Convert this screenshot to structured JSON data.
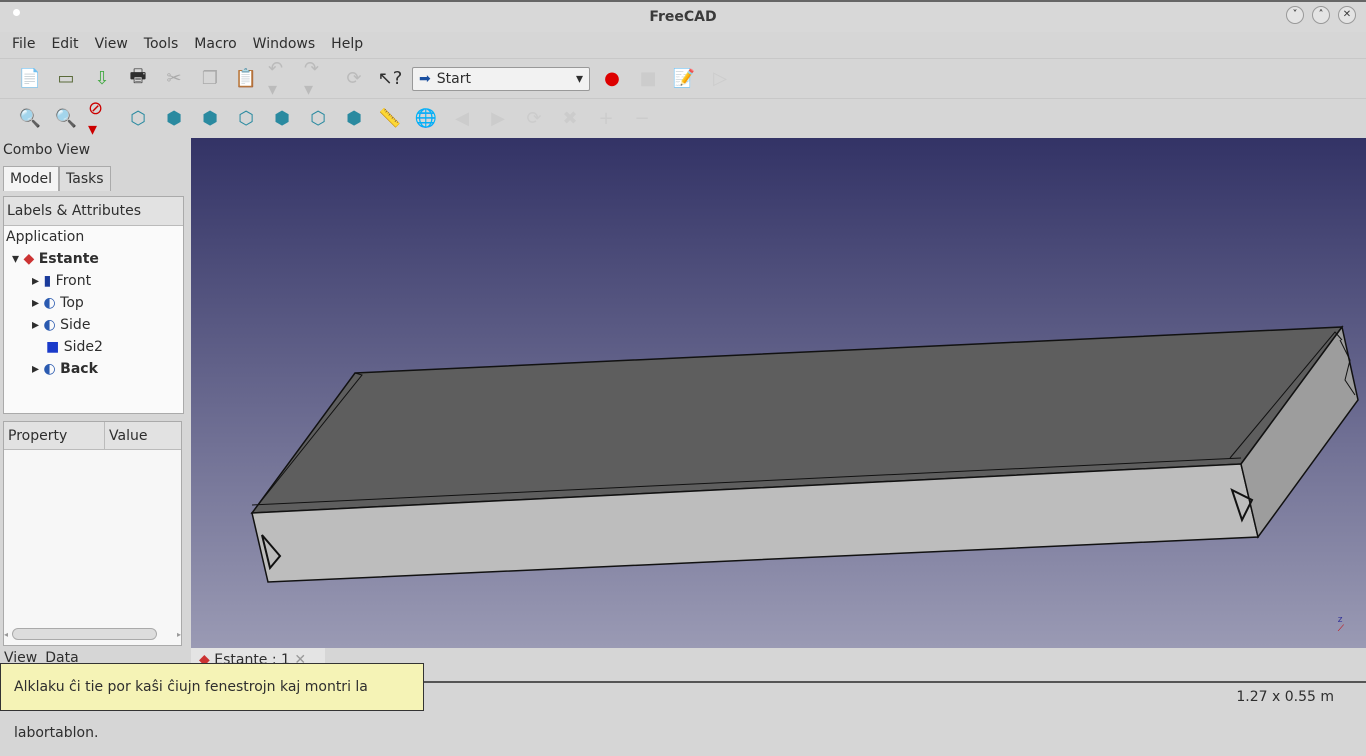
{
  "window": {
    "title": "FreeCAD"
  },
  "menu": [
    "File",
    "Edit",
    "View",
    "Tools",
    "Macro",
    "Windows",
    "Help"
  ],
  "toolbar": {
    "workbench": "Start"
  },
  "combo": {
    "title": "Combo View",
    "tabs": [
      "Model",
      "Tasks"
    ],
    "tree_header": "Labels & Attributes",
    "root": "Application",
    "doc": "Estante",
    "items": [
      {
        "label": "Front",
        "bold": false
      },
      {
        "label": "Top",
        "bold": false
      },
      {
        "label": "Side",
        "bold": false
      },
      {
        "label": "Side2",
        "bold": false
      },
      {
        "label": "Back",
        "bold": true
      }
    ],
    "prop_headers": [
      "Property",
      "Value"
    ],
    "bottom_tabs": [
      "View",
      "Data"
    ]
  },
  "doc_tab": "Estante : 1",
  "tooltip": "Alklaku ĉi tie por kaŝi ĉiujn fenestrojn kaj montri la labortablon.",
  "status": {
    "dimensions": "1.27 x 0.55 m"
  }
}
